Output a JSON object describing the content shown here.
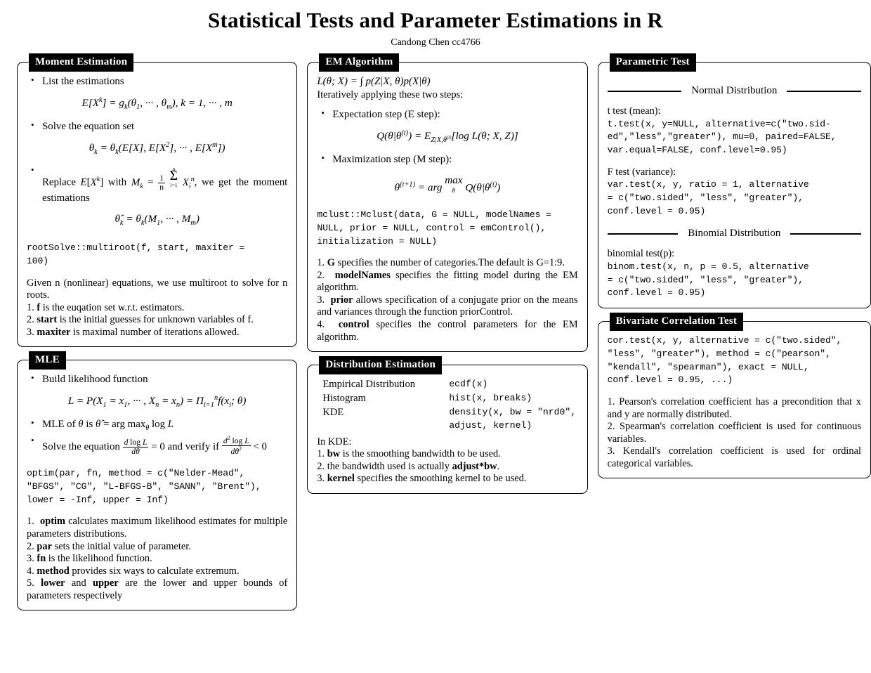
{
  "header": {
    "title": "Statistical Tests and Parameter Estimations in R",
    "author": "Candong Chen cc4766"
  },
  "colors": {
    "ink": "#000000",
    "paper": "#ffffff",
    "title_tab_bg": "#000000",
    "title_tab_fg": "#ffffff"
  },
  "columns": {
    "col1": {
      "boxes": [
        {
          "title": "Moment Estimation",
          "bullets": [
            "List the estimations",
            "Solve the equation set",
            "Replace E[X^k] with M_k = (1/n) sum_{i=1}^{n} X_i^n, we get the moment estimations"
          ],
          "equations": [
            "E[X^k] = g_k(θ_1, ⋯ , θ_m), k = 1, ⋯ , m",
            "θ_k = θ_k(E[X], E[X^2], ⋯ , E[X^m])",
            "θ̂_k = θ_k(M_1, ⋯ , M_m)"
          ],
          "code": "rootSolve::multiroot(f, start, maxiter =\n100)",
          "note": "Given n (nonlinear) equations, we use multiroot to solve for n roots.",
          "numbered": [
            {
              "n": "1.",
              "term": "f",
              "rest": " is the euqation set w.r.t. estimators."
            },
            {
              "n": "2.",
              "term": "start",
              "rest": " is the initial guesses for unknown variables of f."
            },
            {
              "n": "3.",
              "term": "maxiter",
              "rest": " is maximal number of iterations allowed."
            }
          ]
        },
        {
          "title": "MLE",
          "bullets": [
            "Build likelihood function",
            "MLE of θ is θ̂ = arg max_θ log L",
            "Solve the equation dlogL/dθ = 0 and verify if d²logL/dθ² < 0"
          ],
          "equations": [
            "L = P(X_1 = x_1, ⋯ , X_n = x_n) = Π_{i=1}^{n} f(x_i; θ)"
          ],
          "code": "optim(par, fn, method = c(\"Nelder-Mead\",\n\"BFGS\", \"CG\", \"L-BFGS-B\", \"SANN\", \"Brent\"),\nlower = -Inf, upper = Inf)",
          "numbered": [
            {
              "n": "1.",
              "term": "optim",
              "rest": " calculates maximum likelihood estimates for multiple parameters distributions."
            },
            {
              "n": "2.",
              "term": "par",
              "rest": " sets the initial value of parameter."
            },
            {
              "n": "3.",
              "term": "fn",
              "rest": " is the likelihood function."
            },
            {
              "n": "4.",
              "term": "method",
              "rest": " provides six ways to calculate extremum."
            },
            {
              "n": "5.",
              "term": "lower",
              "term2": "upper",
              "joiner": " and ",
              "rest": " are the lower and upper bounds of parameters respectively"
            }
          ]
        }
      ]
    },
    "col2": {
      "boxes": [
        {
          "title": "EM Algorithm",
          "intro_eq": "L(θ; X) = ∫ p(Z|X, θ)p(X|θ)",
          "intro_text": "Iteratively applying these two steps:",
          "bullets": [
            "Expectation step (E step):",
            "Maximization step (M step):"
          ],
          "equations": [
            "Q(θ|θ^(t)) = E_{Z|X,θ^(t)}[log L(θ; X, Z)]",
            "θ^(t+1) = arg max_θ Q(θ|θ^(t))"
          ],
          "code": "mclust::Mclust(data, G = NULL, modelNames =\nNULL, prior = NULL, control = emControl(),\ninitialization = NULL)",
          "numbered": [
            {
              "n": "1.",
              "term": "G",
              "rest": " specifies the number of categories.The default is G=1:9."
            },
            {
              "n": "2.",
              "term": "modelNames",
              "rest": " specifies the fitting model during the EM algorithm."
            },
            {
              "n": "3.",
              "term": "prior",
              "rest": " allows specification of a conjugate prior on the means and variances through the function priorControl."
            },
            {
              "n": "4.",
              "term": "control",
              "rest": " specifies the control parameters for the EM algorithm."
            }
          ]
        },
        {
          "title": "Distribution Estimation",
          "rows": [
            {
              "label": "Empirical Distribution",
              "code": "ecdf(x)"
            },
            {
              "label": "Histogram",
              "code": "hist(x, breaks)"
            },
            {
              "label": "KDE",
              "code": "density(x, bw = \"nrd0\",\nadjust, kernel)"
            }
          ],
          "note": "In KDE:",
          "numbered": [
            {
              "n": "1.",
              "term": "bw",
              "rest": " is the smoothing bandwidth to be used."
            },
            {
              "n": "2.",
              "pre": " the bandwidth used is actually ",
              "term": "adjust*bw",
              "rest": "."
            },
            {
              "n": "3.",
              "term": "kernel",
              "rest": " specifies the smoothing kernel to be used."
            }
          ]
        }
      ]
    },
    "col3": {
      "boxes": [
        {
          "title": "Parametric Test",
          "sections": [
            {
              "divider": "Normal Distribution",
              "items": [
                {
                  "label": "t test (mean):",
                  "code": "t.test(x, y=NULL, alternative=c(\"two.sid-\ned\",\"less\",\"greater\"), mu=0, paired=FALSE,\nvar.equal=FALSE, conf.level=0.95)"
                },
                {
                  "label": "F test (variance):",
                  "code": "var.test(x, y, ratio = 1, alternative\n= c(\"two.sided\", \"less\", \"greater\"),\nconf.level = 0.95)"
                }
              ]
            },
            {
              "divider": "Binomial Distribution",
              "items": [
                {
                  "label": "binomial test(p):",
                  "code": "binom.test(x, n, p = 0.5, alternative\n= c(\"two.sided\", \"less\", \"greater\"),\nconf.level = 0.95)"
                }
              ]
            }
          ]
        },
        {
          "title": "Bivariate Correlation Test",
          "code": "cor.test(x, y, alternative = c(\"two.sided\",\n\"less\", \"greater\"), method = c(\"pearson\",\n\"kendall\", \"spearman\"), exact = NULL,\nconf.level = 0.95, ...)",
          "numbered": [
            {
              "n": "1.",
              "rest": "Pearson's correlation coefficient has a precondition that x and y are normally distributed."
            },
            {
              "n": "2.",
              "rest": "Spearman's correlation coefficient is used for continuous variables."
            },
            {
              "n": "3.",
              "rest": "Kendall's correlation coefficient is used for ordinal categorical variables."
            }
          ]
        }
      ]
    }
  }
}
